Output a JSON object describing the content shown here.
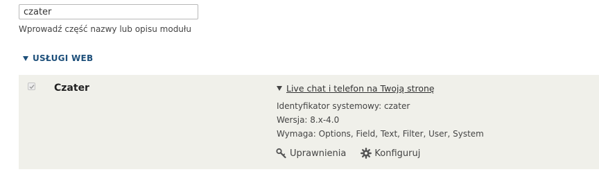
{
  "filter": {
    "value": "czater",
    "help": "Wprowadź część nazwy lub opisu modułu"
  },
  "section": {
    "title": "USŁUGI WEB"
  },
  "module": {
    "name": "Czater",
    "enabled": true,
    "description": "Live chat i telefon na Twoją stronę",
    "machine_name": "Identyfikator systemowy: czater",
    "version": "Wersja: 8.x-4.0",
    "requires": "Wymaga: Options, Field, Text, Filter, User, System",
    "links": {
      "permissions": "Uprawnienia",
      "configure": "Konfiguruj"
    }
  },
  "icons": {
    "section_toggle": "triangle-down-icon",
    "description_toggle": "triangle-down-icon",
    "permissions": "key-icon",
    "configure": "gear-icon",
    "checkbox": "check-icon"
  },
  "colors": {
    "section_header": "#1d4f7a",
    "row_background": "#f0f0ea"
  }
}
